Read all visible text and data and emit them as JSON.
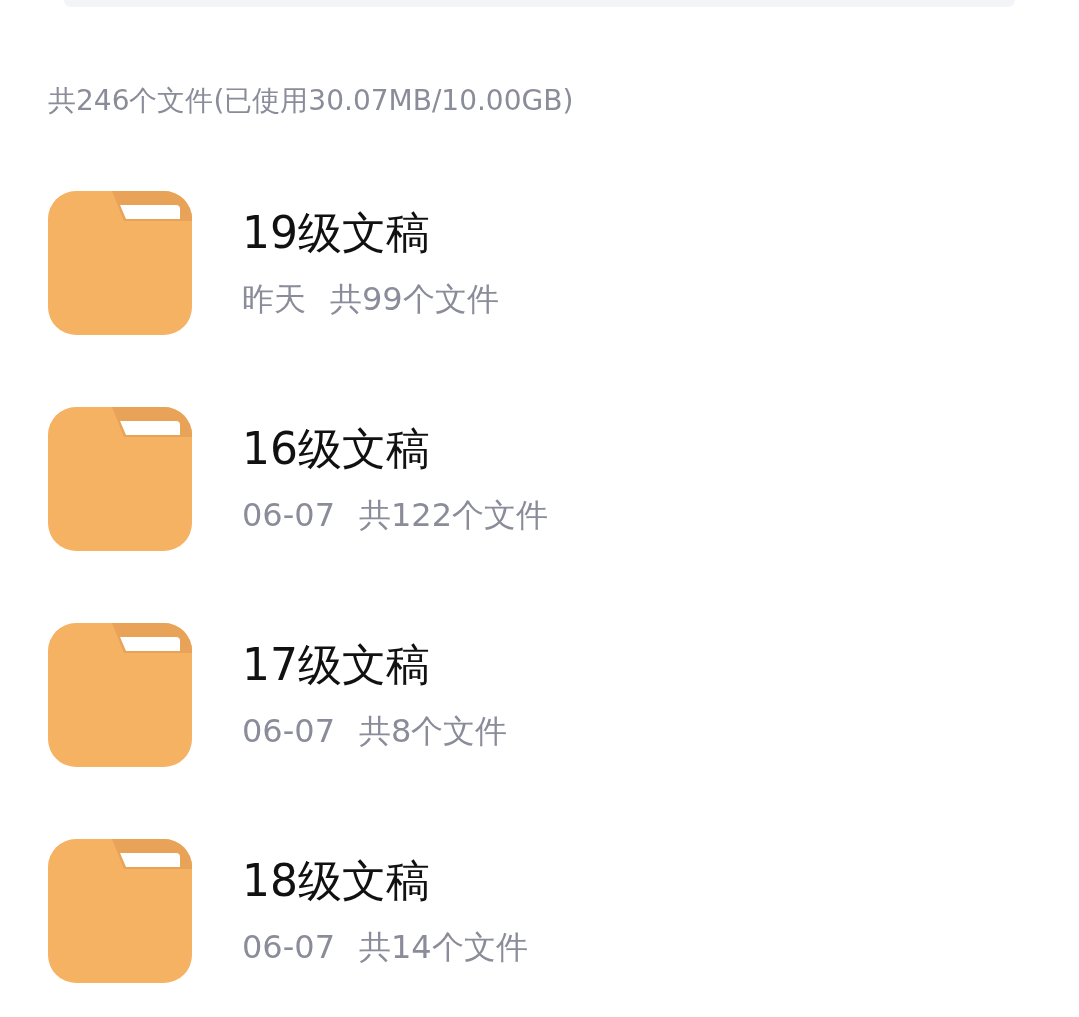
{
  "summary": "共246个文件(已使用30.07MB/10.00GB)",
  "folders": [
    {
      "name": "19级文稿",
      "date": "昨天",
      "count": "共99个文件"
    },
    {
      "name": "16级文稿",
      "date": "06-07",
      "count": "共122个文件"
    },
    {
      "name": "17级文稿",
      "date": "06-07",
      "count": "共8个文件"
    },
    {
      "name": "18级文稿",
      "date": "06-07",
      "count": "共14个文件"
    }
  ]
}
